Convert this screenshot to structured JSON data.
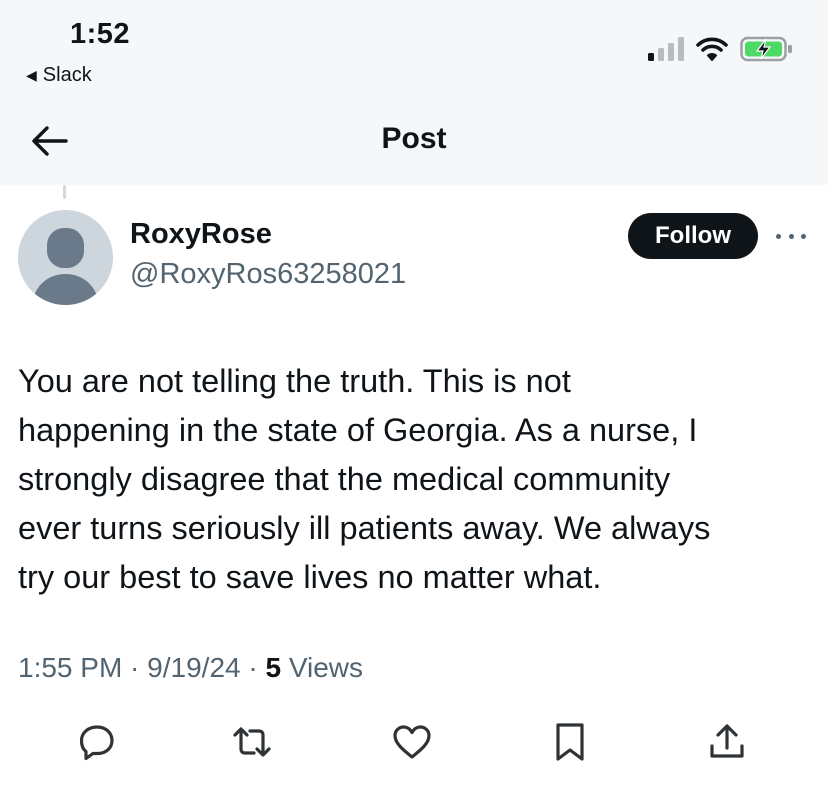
{
  "status_bar": {
    "time": "1:52",
    "back_app": "Slack"
  },
  "header": {
    "title": "Post"
  },
  "author": {
    "name": "RoxyRose",
    "handle": "@RoxyRos63258021",
    "follow_label": "Follow"
  },
  "post": {
    "text": "You are not telling the truth.  This is not\nhappening in the state of Georgia.  As a nurse, I\nstrongly disagree that the medical community\never turns seriously ill patients away.  We always\ntry our best to save lives no matter what.",
    "time": "1:55 PM",
    "sep1": " · ",
    "date": "9/19/24",
    "sep2": " · ",
    "views_count": "5",
    "views_label": " Views"
  },
  "actions": [
    {
      "icon": "reply-icon"
    },
    {
      "icon": "repost-icon"
    },
    {
      "icon": "like-icon"
    },
    {
      "icon": "bookmark-icon"
    },
    {
      "icon": "share-icon"
    }
  ],
  "colors": {
    "text": "#0f1419",
    "secondary": "#536471",
    "battery": "#4cd964",
    "header_bg": "#f6f7f9"
  }
}
